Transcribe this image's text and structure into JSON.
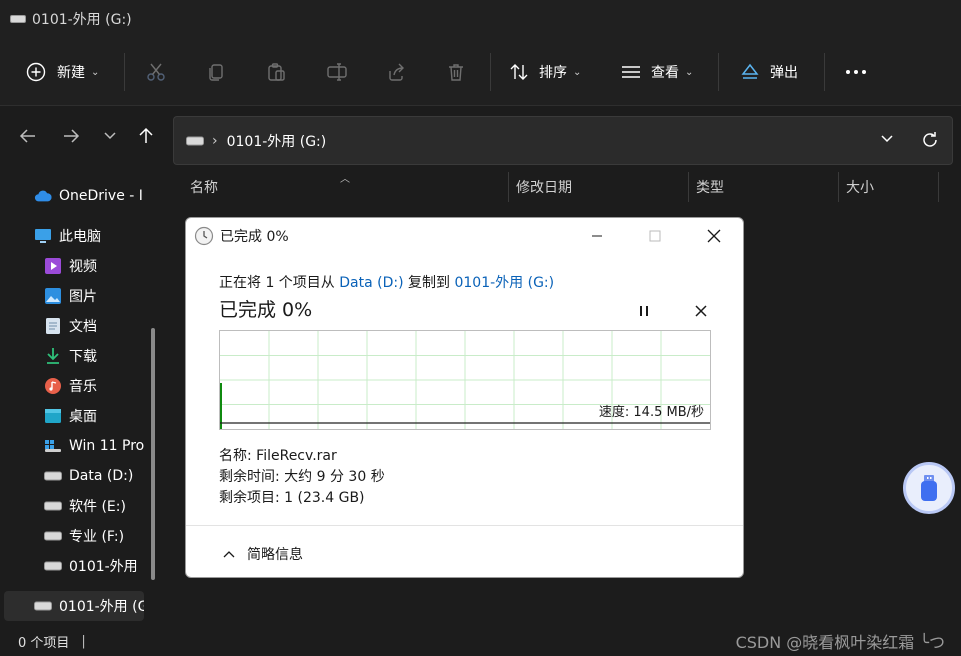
{
  "window": {
    "title": "0101-外用 (G:)"
  },
  "toolbar": {
    "new_label": "新建",
    "sort_label": "排序",
    "view_label": "查看",
    "eject_label": "弹出"
  },
  "navbar": {
    "path": "0101-外用 (G:)"
  },
  "sidebar": {
    "items": [
      {
        "label": "OneDrive - I"
      },
      {
        "label": "此电脑"
      },
      {
        "label": "视频"
      },
      {
        "label": "图片"
      },
      {
        "label": "文档"
      },
      {
        "label": "下载"
      },
      {
        "label": "音乐"
      },
      {
        "label": "桌面"
      },
      {
        "label": "Win 11 Pro"
      },
      {
        "label": "Data (D:)"
      },
      {
        "label": "软件 (E:)"
      },
      {
        "label": "专业 (F:)"
      },
      {
        "label": "0101-外用"
      },
      {
        "label": "0101-外用 (G"
      }
    ]
  },
  "columns": {
    "name": "名称",
    "modified": "修改日期",
    "type": "类型",
    "size": "大小"
  },
  "status": {
    "count": "0 个项目",
    "watermark": "CSDN @晓看枫叶染红霜 ╰つ"
  },
  "dialog": {
    "title": "已完成 0%",
    "copy_prefix": "正在将 1 个项目从 ",
    "source": "Data (D:)",
    "copy_mid": " 复制到 ",
    "dest": "0101-外用 (G:)",
    "progress_text": "已完成 0%",
    "progress_percent": 0,
    "speed": "速度: 14.5 MB/秒",
    "name_line": "名称: FileRecv.rar",
    "time_line": "剩余时间: 大约 9 分 30 秒",
    "items_line": "剩余项目: 1 (23.4 GB)",
    "less_info": "简略信息"
  },
  "colors": {
    "accent_link": "#0a62b8",
    "graph_grid": "#c9ecc9",
    "graph_fill": "#0f8a0f"
  }
}
